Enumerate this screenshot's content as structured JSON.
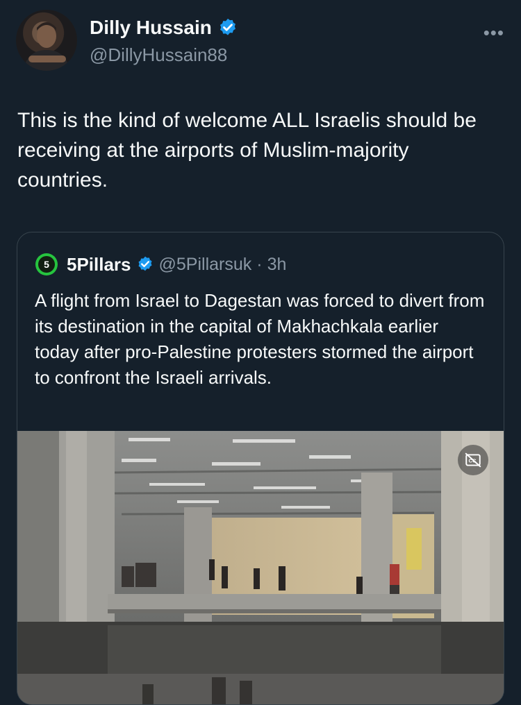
{
  "author": {
    "display_name": "Dilly Hussain",
    "handle": "@DillyHussain88",
    "verified": true,
    "verified_color": "#1d9bf0"
  },
  "more_icon": "more-horizontal-icon",
  "more_label": "•••",
  "tweet": {
    "text": "This is the kind of welcome ALL Israelis should be receiving at the airports of Muslim-majority countries."
  },
  "quoted": {
    "avatar_label": "5",
    "display_name": "5Pillars",
    "handle": "@5Pillarsuk",
    "separator": "·",
    "time": "3h",
    "text": "A flight from Israel to Dagestan was forced to divert from its destination in the capital of Makhachkala earlier today after pro-Palestine protesters stormed the airport to confront the Israeli arrivals.",
    "media_type": "video",
    "captions_icon": "closed-captions-off-icon"
  },
  "colors": {
    "background": "#15202b",
    "text": "#f7f9f9",
    "secondary_text": "#8b98a5",
    "border": "#38444d",
    "brand_green": "#26c43f"
  }
}
